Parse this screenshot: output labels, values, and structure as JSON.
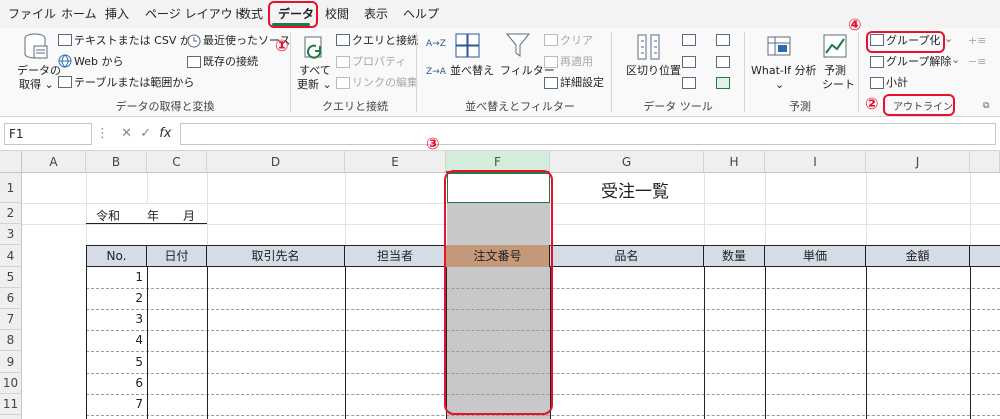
{
  "tabs": [
    "ファイル",
    "ホーム",
    "挿入",
    "ページ レイアウト",
    "数式",
    "データ",
    "校閲",
    "表示",
    "ヘルプ"
  ],
  "active_tab": "データ",
  "ribbon": {
    "get_data": {
      "label_line1": "データの",
      "label_line2": "取得 ⌄"
    },
    "text_csv": "テキストまたは CSV から",
    "web": "Web から",
    "table_range": "テーブルまたは範囲から",
    "recent_sources": "最近使ったソース",
    "existing_conn": "既存の接続",
    "group1_label": "データの取得と変換",
    "refresh_all": {
      "line1": "すべて",
      "line2": "更新 ⌄"
    },
    "queries_conn": "クエリと接続",
    "properties": "プロパティ",
    "edit_links": "リンクの編集",
    "group2_label": "クエリと接続",
    "sort_az": "A→Z",
    "sort_za": "Z→A",
    "sort": "並べ替え",
    "filter": "フィルター",
    "clear": "クリア",
    "reapply": "再適用",
    "advanced": "詳細設定",
    "group3_label": "並べ替えとフィルター",
    "text_to_columns": "区切り位置",
    "group4_label": "データ ツール",
    "whatif": {
      "line1": "What-If 分析",
      "line2": "⌄"
    },
    "forecast": {
      "line1": "予測",
      "line2": "シート"
    },
    "group5_label": "予測",
    "group_btn": "グループ化",
    "ungroup_btn": "グループ解除",
    "subtotal": "小計",
    "outline_label": "アウトライン",
    "group_dropdown": "⌄"
  },
  "formula_bar": {
    "name_box": "F1",
    "fx_symbol": "fx",
    "value": ""
  },
  "columns": [
    "A",
    "B",
    "C",
    "D",
    "E",
    "F",
    "G",
    "H",
    "I",
    "J"
  ],
  "rows": [
    "1",
    "2",
    "3",
    "4",
    "5",
    "6",
    "7",
    "8",
    "9",
    "10",
    "11"
  ],
  "sheet": {
    "title": "受注一覧",
    "reiwa_label": "令和",
    "year_label": "年",
    "month_label": "月",
    "headers": [
      "No.",
      "日付",
      "取引先名",
      "担当者",
      "注文番号",
      "品名",
      "数量",
      "単価",
      "金額"
    ],
    "numbers": [
      "1",
      "2",
      "3",
      "4",
      "5",
      "6",
      "7"
    ]
  },
  "annotations": {
    "step1": "①",
    "step2": "②",
    "step3": "③",
    "step4": "④"
  },
  "colors": {
    "accent_green": "#1f7a43",
    "highlight_red": "#e8112d",
    "header_fill": "#d6dce5",
    "order_header_fill": "#c4997a",
    "gray_column": "#c8c8c8"
  }
}
